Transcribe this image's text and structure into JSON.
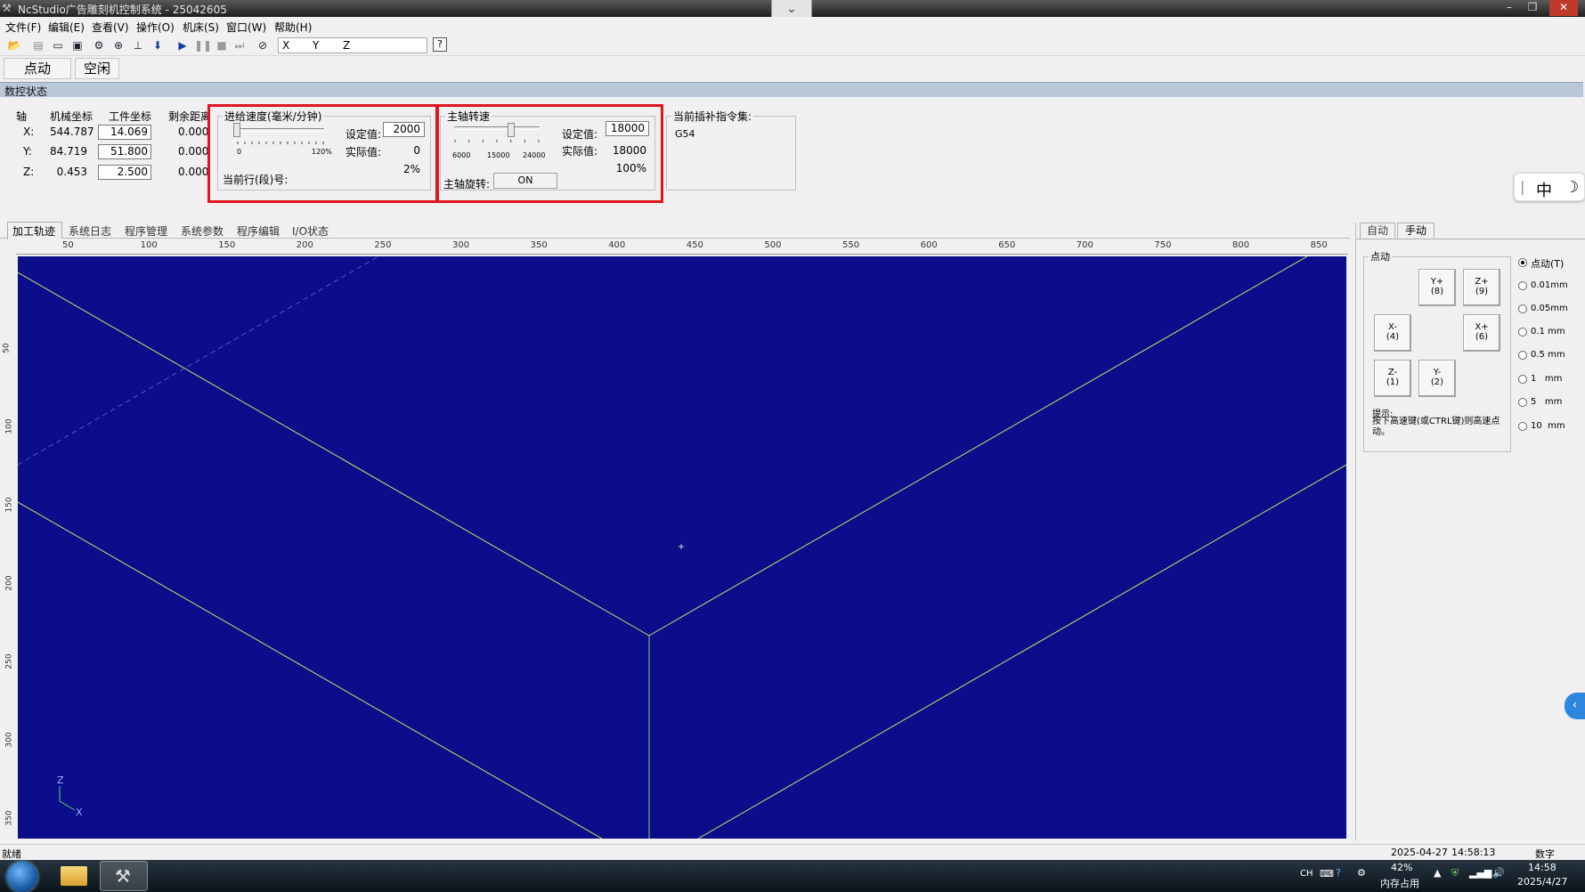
{
  "window": {
    "title": "NcStudio广告雕刻机控制系统 - 25042605"
  },
  "menu": [
    "文件(F)",
    "编辑(E)",
    "查看(V)",
    "操作(O)",
    "机床(S)",
    "窗口(W)",
    "帮助(H)"
  ],
  "toolbar": {
    "coord_axes": [
      "X",
      "Y",
      "Z"
    ],
    "help_label": "?"
  },
  "mode_tabs": [
    "点动",
    "空闲"
  ],
  "status_header": "数控状态",
  "coords": {
    "headers": [
      "轴",
      "机械坐标",
      "工件坐标",
      "剩余距离"
    ],
    "rows": [
      {
        "axis": "X:",
        "machine": "544.787",
        "work": "14.069",
        "remain": "0.000"
      },
      {
        "axis": "Y:",
        "machine": "84.719",
        "work": "51.800",
        "remain": "0.000"
      },
      {
        "axis": "Z:",
        "machine": "0.453",
        "work": "2.500",
        "remain": "0.000"
      }
    ]
  },
  "feed": {
    "title": "进给速度(毫米/分钟)",
    "set_label": "设定值:",
    "set_value": "2000",
    "actual_label": "实际值:",
    "actual_value": "0",
    "percent": "2%",
    "slider_min": "0",
    "slider_max": "120%",
    "slider_fraction": 0.02,
    "current_line_label": "当前行(段)号:"
  },
  "spindle": {
    "title": "主轴转速",
    "set_label": "设定值:",
    "set_value": "18000",
    "actual_label": "实际值:",
    "actual_value": "18000",
    "percent": "100%",
    "scale": [
      "6000",
      "15000",
      "24000"
    ],
    "slider_value": 18000,
    "rotate_label": "主轴旋转:",
    "rotate_state": "ON"
  },
  "interp": {
    "title": "当前插补指令集:",
    "value": "G54"
  },
  "lower_tabs": [
    "加工轨迹",
    "系统日志",
    "程序管理",
    "系统参数",
    "程序编辑",
    "I/O状态"
  ],
  "ruler_marks": [
    "50",
    "100",
    "150",
    "200",
    "250",
    "300",
    "350",
    "400",
    "450",
    "500",
    "550",
    "600",
    "650",
    "700",
    "750",
    "800",
    "850"
  ],
  "vruler_marks": [
    "50",
    "100",
    "150",
    "200",
    "250",
    "300",
    "350"
  ],
  "canvas": {
    "background": "#0b0d8a",
    "line_color": "#cfe36a",
    "axis_x_label": "X",
    "axis_z_label": "Z"
  },
  "right_panel": {
    "tabs": [
      "自动",
      "手动"
    ],
    "jog_group": "点动",
    "buttons": [
      {
        "label": "Y+",
        "key": "(8)"
      },
      {
        "label": "Z+",
        "key": "(9)"
      },
      {
        "label": "X-",
        "key": "(4)"
      },
      {
        "label": "X+",
        "key": "(6)"
      },
      {
        "label": "Z-",
        "key": "(1)"
      },
      {
        "label": "Y-",
        "key": "(2)"
      }
    ],
    "hint_title": "提示:",
    "hint_text": "按下高速键(或CTRL键)则高速点动。",
    "step_options": [
      {
        "label": "点动(T)",
        "selected": true
      },
      {
        "label": "0.01mm",
        "selected": false
      },
      {
        "label": "0.05mm",
        "selected": false
      },
      {
        "label": "0.1 mm",
        "selected": false
      },
      {
        "label": "0.5 mm",
        "selected": false
      },
      {
        "label": "1   mm",
        "selected": false
      },
      {
        "label": "5   mm",
        "selected": false
      },
      {
        "label": "10  mm",
        "selected": false
      }
    ]
  },
  "statusbar": {
    "left": "就绪",
    "date": "2025-04-27",
    "time": "14:58:13",
    "mode": "数字"
  },
  "taskbar": {
    "lang": "CH",
    "mem_percent": "42%",
    "mem_label": "内存占用",
    "clock_time": "14:58",
    "clock_date": "2025/4/27"
  },
  "ime": {
    "mode_char": "中"
  }
}
